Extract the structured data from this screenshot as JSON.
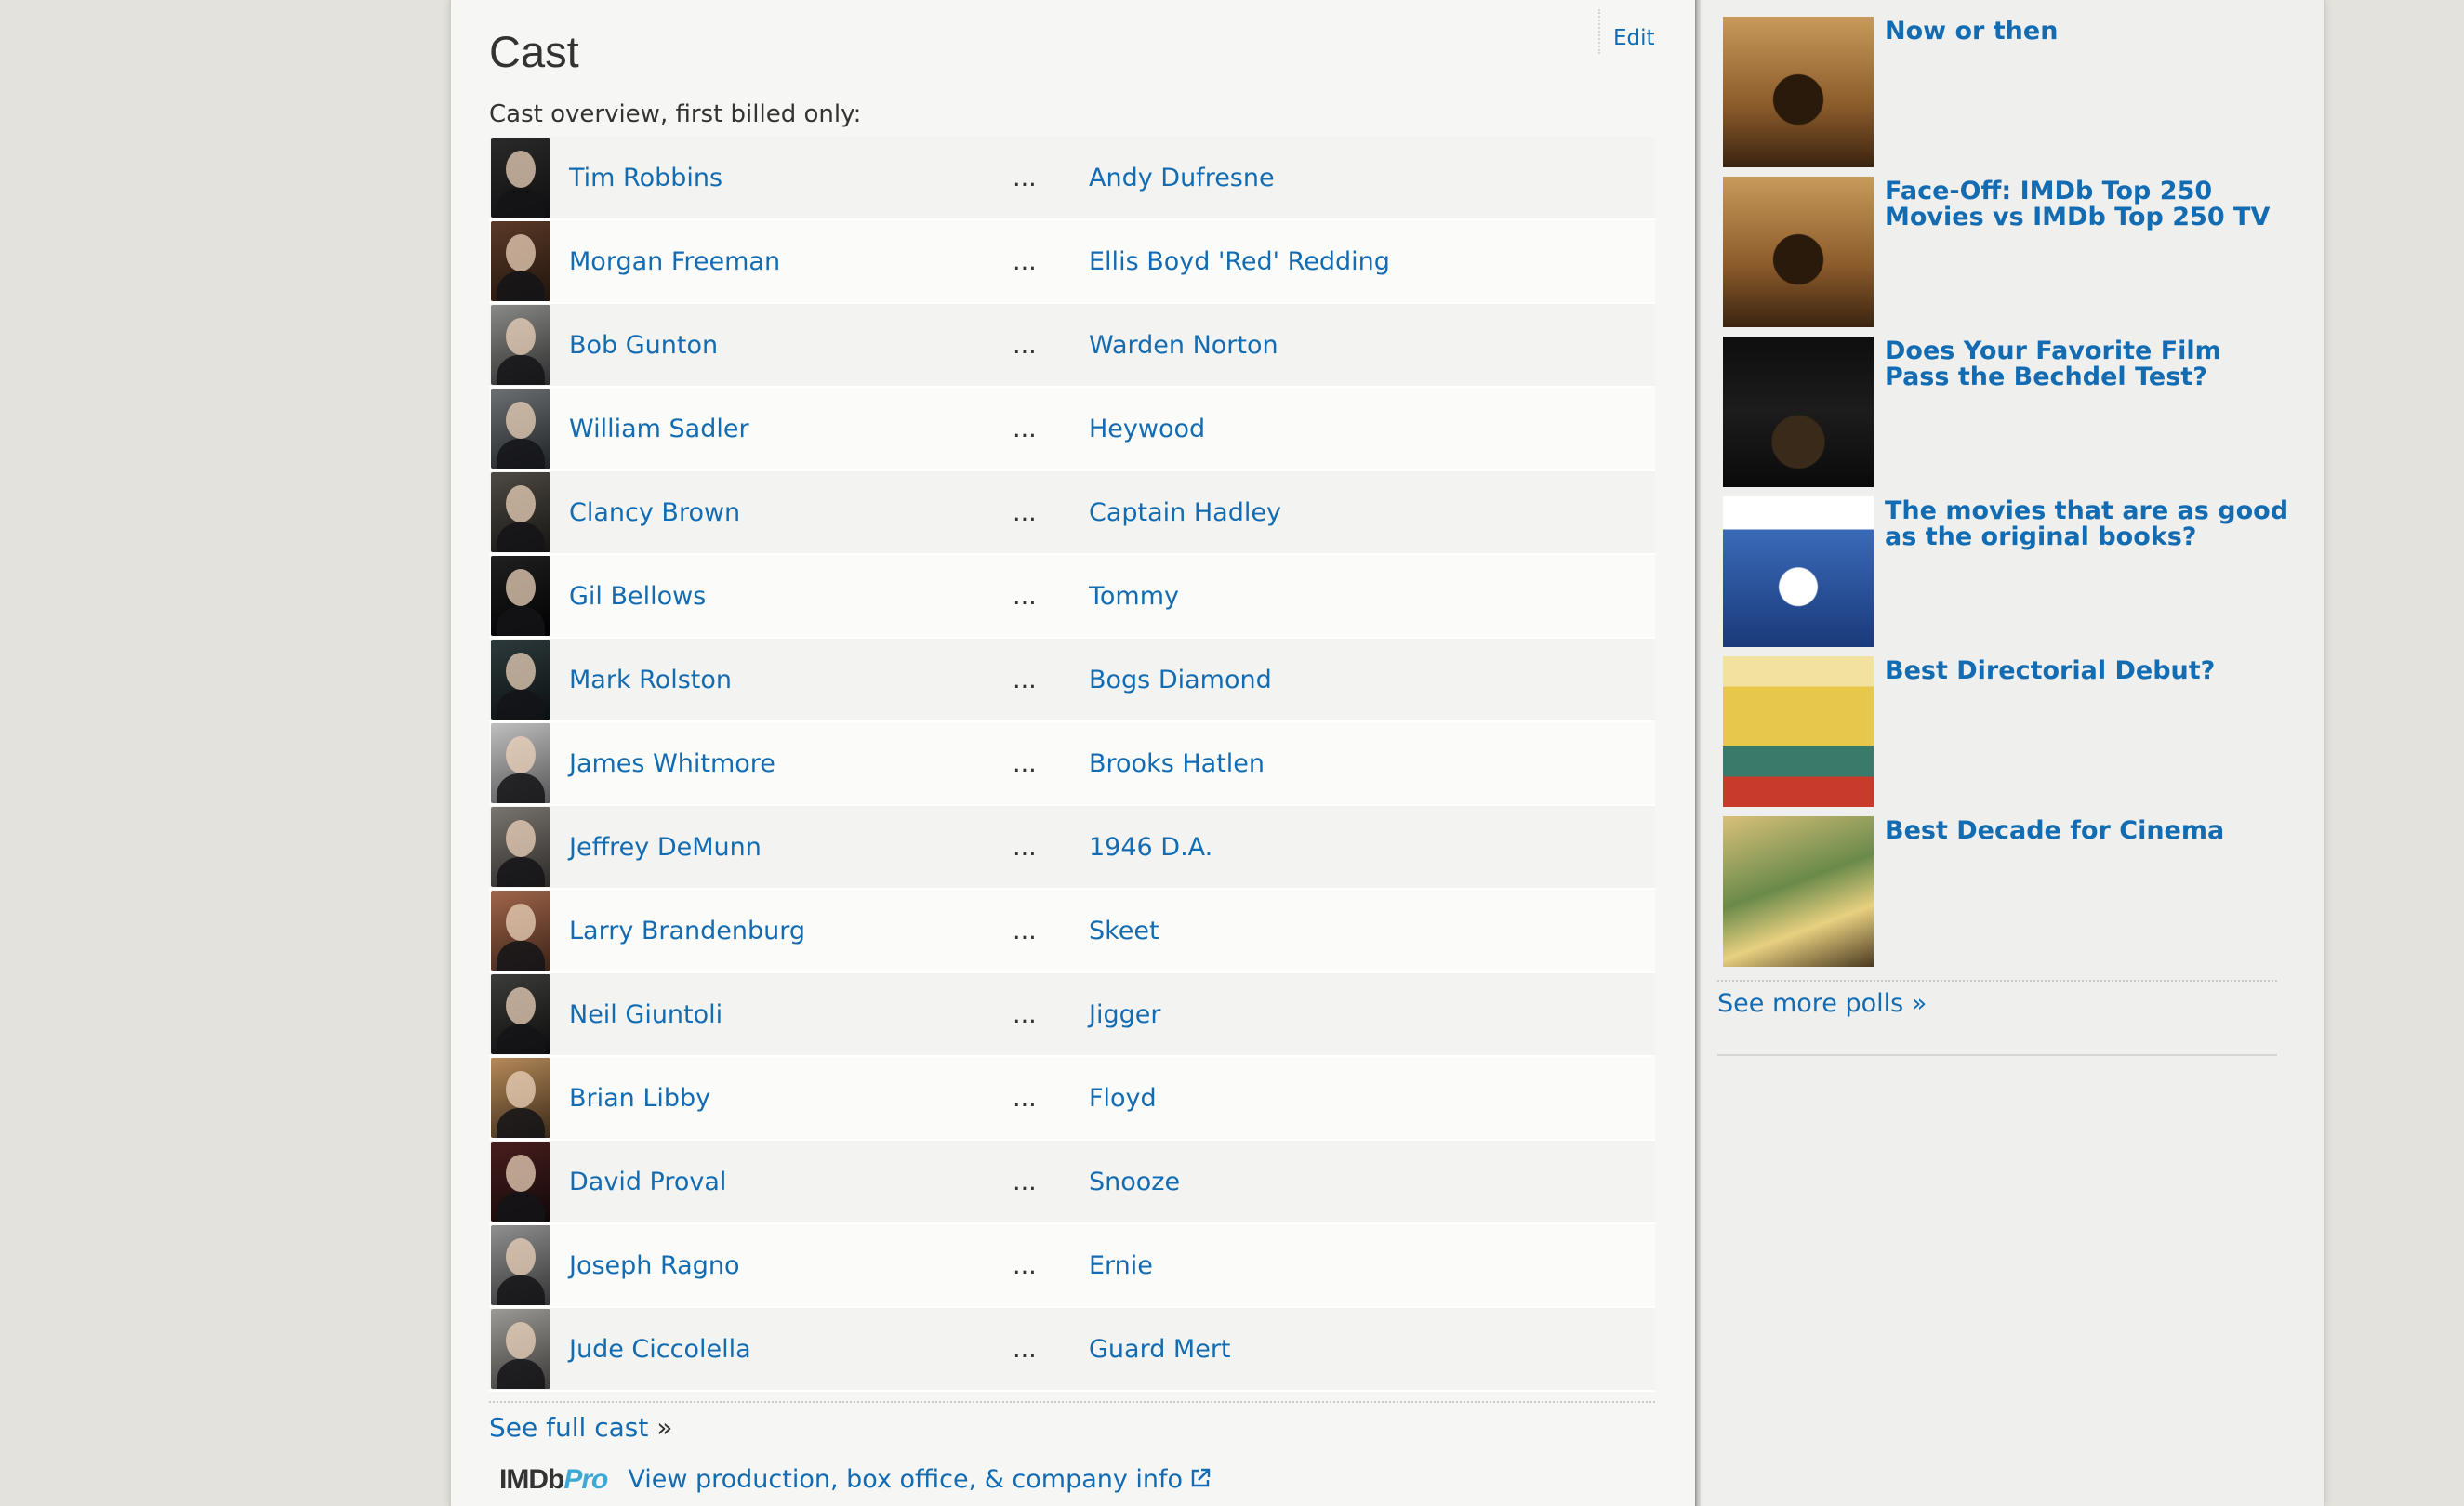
{
  "cast": {
    "title": "Cast",
    "edit_label": "Edit",
    "subtitle": "Cast overview, first billed only:",
    "separator": "...",
    "rows": [
      {
        "actor": "Tim Robbins",
        "character": "Andy Dufresne"
      },
      {
        "actor": "Morgan Freeman",
        "character": "Ellis Boyd 'Red' Redding"
      },
      {
        "actor": "Bob Gunton",
        "character": "Warden Norton"
      },
      {
        "actor": "William Sadler",
        "character": "Heywood"
      },
      {
        "actor": "Clancy Brown",
        "character": "Captain Hadley"
      },
      {
        "actor": "Gil Bellows",
        "character": "Tommy"
      },
      {
        "actor": "Mark Rolston",
        "character": "Bogs Diamond"
      },
      {
        "actor": "James Whitmore",
        "character": "Brooks Hatlen"
      },
      {
        "actor": "Jeffrey DeMunn",
        "character": "1946 D.A."
      },
      {
        "actor": "Larry Brandenburg",
        "character": "Skeet"
      },
      {
        "actor": "Neil Giuntoli",
        "character": "Jigger"
      },
      {
        "actor": "Brian Libby",
        "character": "Floyd"
      },
      {
        "actor": "David Proval",
        "character": "Snooze"
      },
      {
        "actor": "Joseph Ragno",
        "character": "Ernie"
      },
      {
        "actor": "Jude Ciccolella",
        "character": "Guard Mert"
      }
    ],
    "see_full_cast_label": "See full cast",
    "see_full_cast_arrow": "»",
    "imdbpro_logo_imdb": "IMDb",
    "imdbpro_logo_pro": "Pro",
    "imdbpro_link": "View production, box office, & company info"
  },
  "sidebar": {
    "polls": [
      {
        "title": "Now or then",
        "icon": "movie-poster-icon"
      },
      {
        "title": "Face-Off: IMDb Top 250 Movies vs IMDb Top 250 TV",
        "icon": "movie-poster-icon"
      },
      {
        "title": "Does Your Favorite Film Pass the Bechdel Test?",
        "icon": "movie-poster-icon"
      },
      {
        "title": "The movies that are as good as the original books?",
        "icon": "movie-poster-icon"
      },
      {
        "title": "Best Directorial Debut?",
        "icon": "movie-poster-icon"
      },
      {
        "title": "Best Decade for Cinema",
        "icon": "movie-poster-icon"
      }
    ],
    "see_more_label": "See more polls »"
  },
  "colors": {
    "link": "#136cb2",
    "text": "#333333",
    "page_background": "#f6f6f5",
    "body_background": "#e3e2dd",
    "imdbpro_accent": "#3fa9d6"
  }
}
